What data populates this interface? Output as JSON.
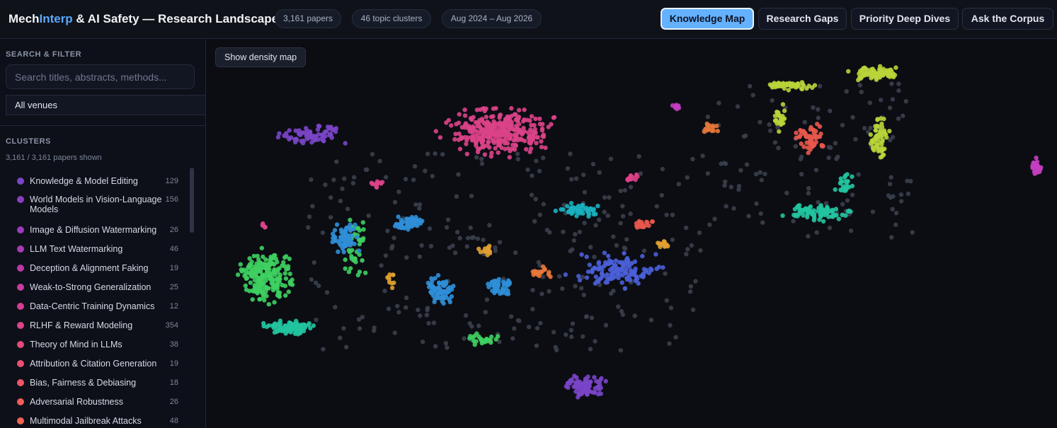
{
  "header": {
    "title_part1": "Mech",
    "title_part2": "Interp",
    "title_part3": " & AI Safety — Research Landscape",
    "stats": [
      "3,161 papers",
      "46 topic clusters",
      "Aug 2024 – Aug 2026"
    ],
    "nav": [
      {
        "label": "Knowledge Map",
        "active": true
      },
      {
        "label": "Research Gaps",
        "active": false
      },
      {
        "label": "Priority Deep Dives",
        "active": false
      },
      {
        "label": "Ask the Corpus",
        "active": false
      }
    ]
  },
  "sidebar": {
    "search_heading": "SEARCH & FILTER",
    "search_placeholder": "Search titles, abstracts, methods...",
    "venue_value": "All venues",
    "clusters_heading": "CLUSTERS",
    "shown_count": "3,161 / 3,161 papers shown",
    "clusters": [
      {
        "name": "Knowledge & Model Editing",
        "count": "129",
        "color": "#7a45c8"
      },
      {
        "name": "World Models in Vision-Language Models",
        "count": "156",
        "color": "#8a3fc0"
      },
      {
        "name": "Image & Diffusion Watermarking",
        "count": "26",
        "color": "#9a3cba"
      },
      {
        "name": "LLM Text Watermarking",
        "count": "46",
        "color": "#a83ab2"
      },
      {
        "name": "Deception & Alignment Faking",
        "count": "19",
        "color": "#b83aa6"
      },
      {
        "name": "Weak-to-Strong Generalization",
        "count": "25",
        "color": "#c63c9c"
      },
      {
        "name": "Data-Centric Training Dynamics",
        "count": "12",
        "color": "#d23e92"
      },
      {
        "name": "RLHF & Reward Modeling",
        "count": "354",
        "color": "#dc4388"
      },
      {
        "name": "Theory of Mind in LLMs",
        "count": "38",
        "color": "#e44a7c"
      },
      {
        "name": "Attribution & Citation Generation",
        "count": "19",
        "color": "#ea5070"
      },
      {
        "name": "Bias, Fairness & Debiasing",
        "count": "18",
        "color": "#ef5666"
      },
      {
        "name": "Adversarial Robustness",
        "count": "26",
        "color": "#f25c5a"
      },
      {
        "name": "Multimodal Jailbreak Attacks",
        "count": "48",
        "color": "#f4624f"
      }
    ]
  },
  "map": {
    "density_button": "Show density map",
    "point_colors": {
      "knowledge_editing": "#7a45c8",
      "rlhf": "#dc4388",
      "lime": "#b8d43a",
      "green": "#3ecf60",
      "teal": "#22c4a0",
      "cyan": "#1ab0c0",
      "blue": "#2f8fd8",
      "indigo": "#4a5fd8",
      "red": "#e8584c",
      "orange": "#e8783a",
      "amber": "#e0a030",
      "gray": "#3a3f4d",
      "magenta": "#c43ec0"
    }
  }
}
